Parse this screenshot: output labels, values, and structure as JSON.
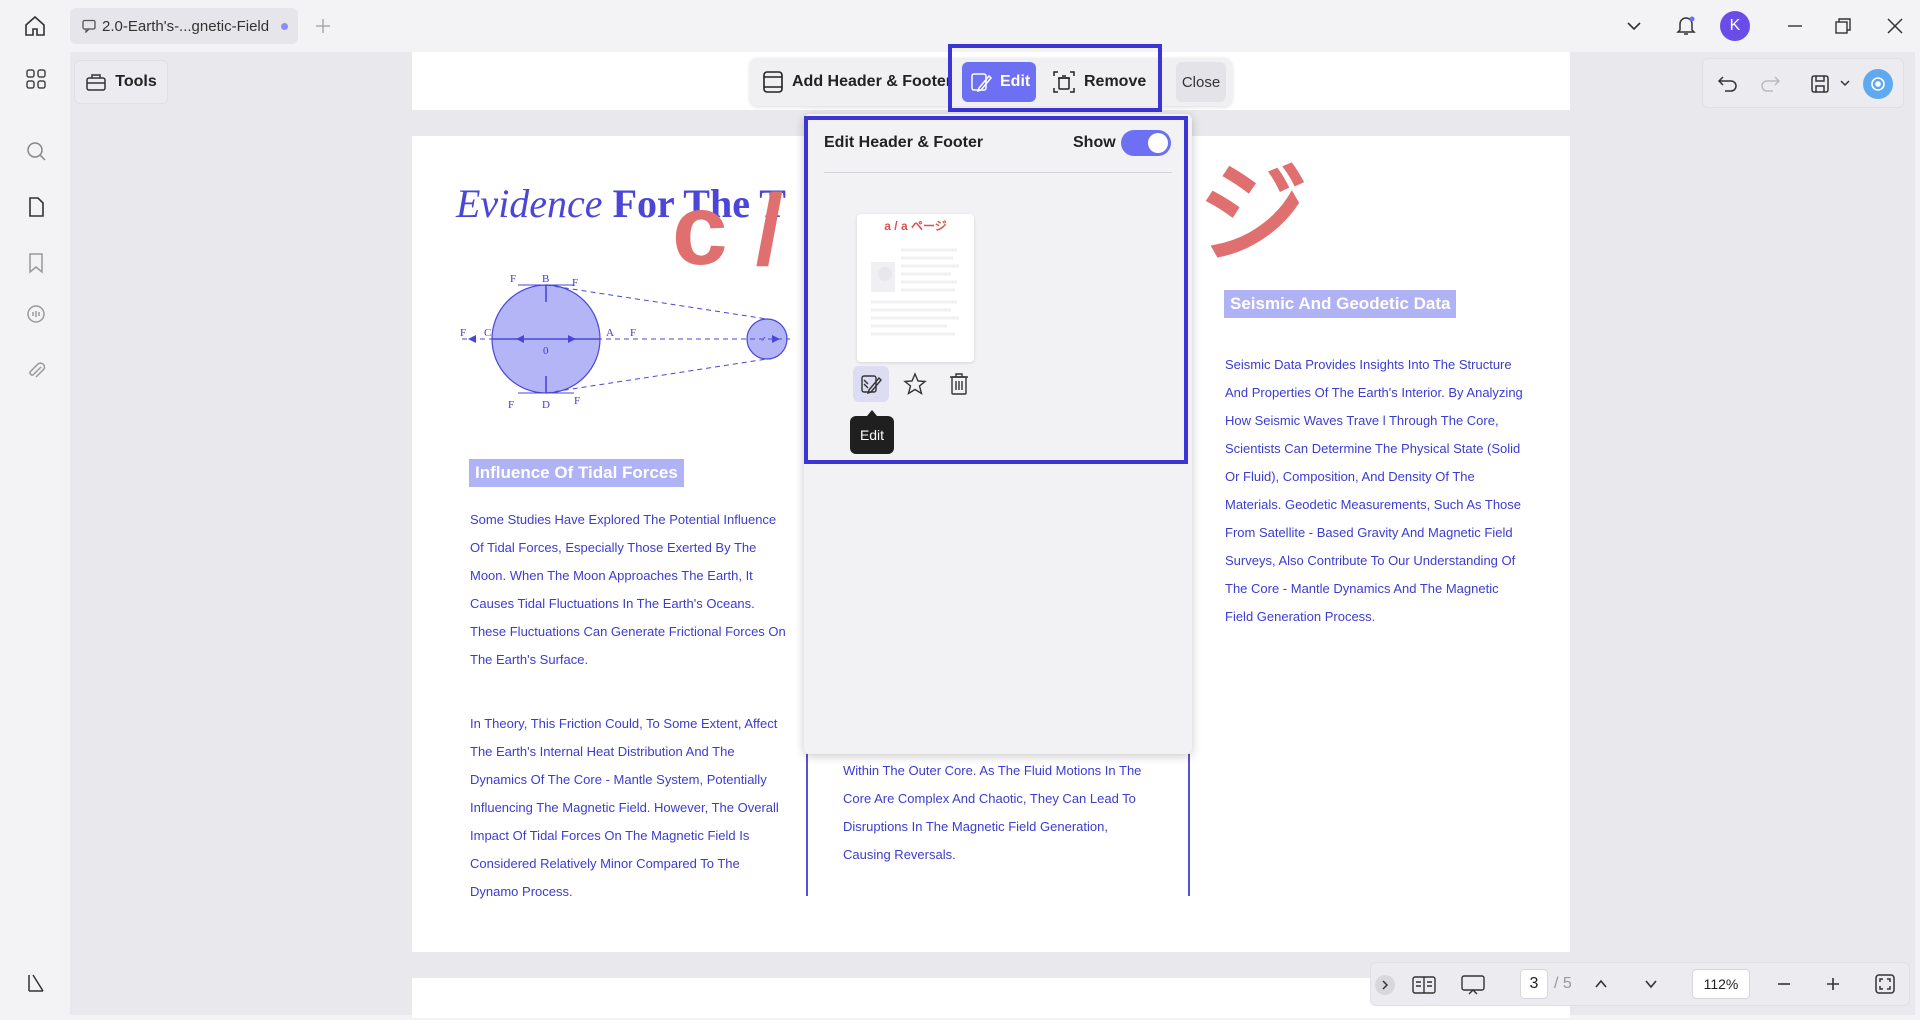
{
  "window": {
    "tab_title": "2.0-Earth's-...gnetic-Field",
    "avatar_letter": "K"
  },
  "tools": {
    "label": "Tools"
  },
  "header_footer_toolbar": {
    "add_label": "Add Header & Footer",
    "edit_label": "Edit",
    "remove_label": "Remove",
    "close_label": "Close"
  },
  "panel": {
    "title": "Edit Header & Footer",
    "show_label": "Show",
    "show_enabled": true,
    "template_label": "a / a ページ",
    "tooltip": "Edit"
  },
  "document": {
    "title_italic": "Evidence",
    "title_bold": "For The T",
    "watermark_c": "c /",
    "watermark_ji": "ジ",
    "section_tidal": "Influence Of Tidal Forces",
    "section_seismic": "Seismic And Geodetic Data",
    "para_tidal_1": "Some Studies Have Explored The Potential Influence Of Tidal Forces, Especially Those Exerted By The Moon. When The Moon Approaches The Earth, It Causes Tidal Fluctuations In The Earth's Oceans. These Fluctuations Can Generate Frictional Forces On The Earth's Surface.",
    "para_tidal_2": "In Theory, This Friction Could, To Some Extent, Affect The Earth's Internal Heat Distribution And The Dynamics Of The Core - Mantle System, Potentially Influencing The Magnetic Field. However, The Overall Impact Of Tidal Forces On The Magnetic Field Is Considered Relatively Minor Compared To The Dynamo Process.",
    "para_middle": "Within The Outer Core. As The Fluid Motions In The Core Are Complex And Chaotic, They Can Lead To Disruptions In The Magnetic Field Generation, Causing Reversals.",
    "para_seismic": "Seismic Data Provides Insights Into The Structure And Properties Of The Earth's Interior. By Analyzing How Seismic Waves Trave l Through The Core, Scientists Can Determine The Physical State (Solid Or Fluid), Composition, And Density Of The Materials. Geodetic Measurements, Such As Those From Satellite - Based Gravity And Magnetic Field Surveys, Also Contribute To Our Understanding Of The Core - Mantle Dynamics And The Magnetic Field Generation Process.",
    "diagram_labels": [
      "B",
      "D",
      "C",
      "A",
      "0",
      "F",
      "F",
      "F",
      "F"
    ]
  },
  "status_bar": {
    "page_current": "3",
    "page_total": "/ 5",
    "zoom": "112%"
  },
  "colors": {
    "accent": "#6d70f3",
    "highlight_frame": "#3b35d6",
    "doc_text": "#3c3ccf",
    "watermark": "#e0706f"
  }
}
